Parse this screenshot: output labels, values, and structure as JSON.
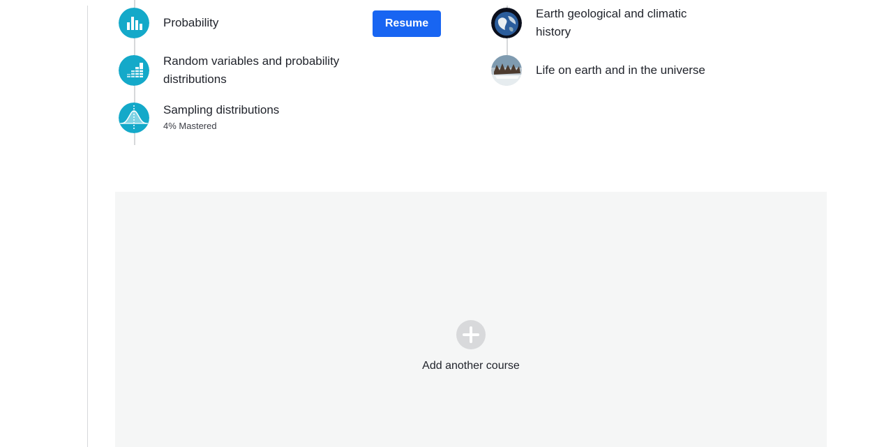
{
  "course_left": {
    "units": [
      {
        "title": "Probability",
        "icon": "bar-chart-icon"
      },
      {
        "title": "Random variables and probability distributions",
        "icon": "histogram-icon"
      },
      {
        "title": "Sampling distributions",
        "subtitle": "4% Mastered",
        "icon": "bell-curve-icon"
      }
    ],
    "resume_label": "Resume"
  },
  "course_right": {
    "units": [
      {
        "title": "Earth geological and climatic history",
        "icon": "earth-icon"
      },
      {
        "title": "Life on earth and in the universe",
        "icon": "wildlife-icon"
      }
    ]
  },
  "add_course": {
    "label": "Add another course",
    "icon": "plus-circle-icon"
  },
  "colors": {
    "accent": "#1865f2",
    "unit_icon": "#14a9c9",
    "panel_bg": "#f5f6f6"
  }
}
